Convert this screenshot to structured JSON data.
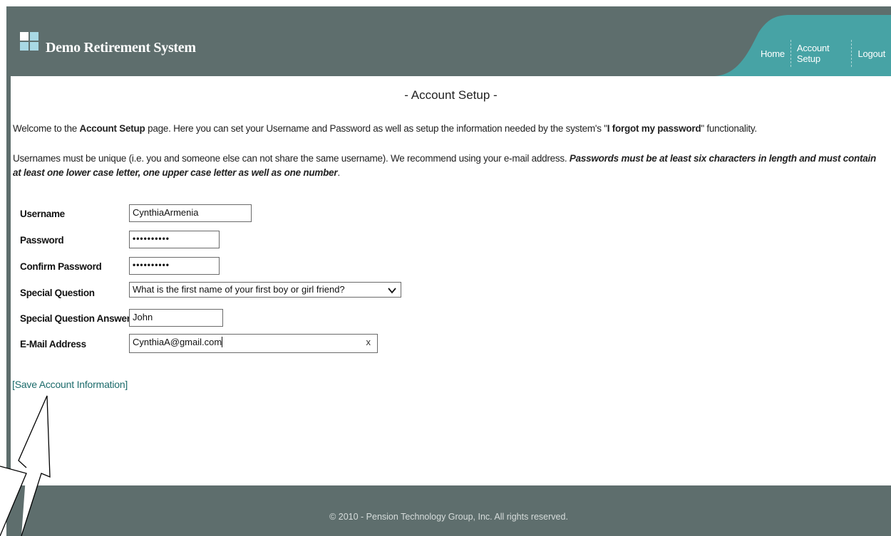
{
  "header": {
    "app_title": "Demo Retirement System",
    "nav": [
      {
        "label": "Home"
      },
      {
        "label": "Account Setup"
      },
      {
        "label": "Logout"
      }
    ]
  },
  "colors": {
    "frame": "#5e6e6d",
    "nav_tab": "#47a3a5",
    "logo_squares": "#a8d8e4",
    "link": "#1c6b6b"
  },
  "page": {
    "title": "- Account Setup -",
    "intro": {
      "p1_a": "Welcome to the ",
      "p1_b": "Account Setup",
      "p1_c": " page. Here you can set your Username and Password as well as setup the information needed by the system's \"",
      "p1_d": "I forgot my password",
      "p1_e": "\" functionality.",
      "p2_a": "Usernames must be unique (i.e. you and someone else can not share the same username). We recommend using your e-mail address. ",
      "p2_b": "Passwords must be at least six characters in length and must contain at least one lower case letter, one upper case letter as well as one number",
      "p2_c": "."
    }
  },
  "form": {
    "username": {
      "label": "Username",
      "value": "CynthiaArmenia"
    },
    "password": {
      "label": "Password",
      "value": "••••••••••"
    },
    "confirm_password": {
      "label": "Confirm Password",
      "value": "••••••••••"
    },
    "special_question": {
      "label": "Special Question",
      "value": "What is the first name of your first boy or girl friend?"
    },
    "special_answer": {
      "label": "Special Question Answer",
      "value": "John"
    },
    "email": {
      "label": "E-Mail Address",
      "value": "CynthiaA@gmail.com",
      "clear_icon": "x"
    }
  },
  "actions": {
    "save_label": "[Save Account Information]"
  },
  "footer": {
    "text": "© 2010 - Pension Technology Group, Inc. All rights reserved."
  }
}
